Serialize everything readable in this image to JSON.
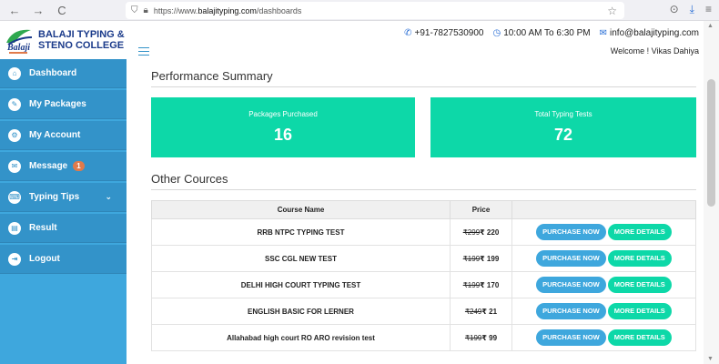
{
  "browser": {
    "back": "←",
    "forward": "→",
    "reload": "C",
    "url_prefix": "https://www.",
    "url_domain": "balajityping.com",
    "url_path": "/dashboards",
    "pocket": "⊙",
    "download": "⤓",
    "menu": "≡"
  },
  "brand": {
    "line1": "BALAJI TYPING &",
    "line2": "STENO COLLEGE",
    "logo_text": "Balaji"
  },
  "sidebar": {
    "items": [
      {
        "label": "Dashboard",
        "icon": "home-icon",
        "glyph": "⌂"
      },
      {
        "label": "My Packages",
        "icon": "edit-icon",
        "glyph": "✎"
      },
      {
        "label": "My Account",
        "icon": "gear-icon",
        "glyph": "⚙"
      },
      {
        "label": "Message",
        "icon": "envelope-icon",
        "glyph": "✉",
        "badge": "1"
      },
      {
        "label": "Typing Tips",
        "icon": "keyboard-icon",
        "glyph": "⌨",
        "chevron": "⌄"
      },
      {
        "label": "Result",
        "icon": "document-icon",
        "glyph": "▤"
      },
      {
        "label": "Logout",
        "icon": "logout-icon",
        "glyph": "⇥"
      }
    ]
  },
  "topbar": {
    "phone": "+91-7827530900",
    "hours": "10:00 AM To 6:30 PM",
    "email": "info@balajityping.com",
    "welcome": "Welcome ! Vikas Dahiya"
  },
  "performance": {
    "title": "Performance Summary",
    "cards": [
      {
        "label": "Packages Purchased",
        "value": "16"
      },
      {
        "label": "Total Typing Tests",
        "value": "72"
      }
    ]
  },
  "courses": {
    "title": "Other Cources",
    "headers": {
      "name": "Course Name",
      "price": "Price"
    },
    "buy_label": "PURCHASE NOW",
    "more_label": "MORE DETAILS",
    "rows": [
      {
        "name": "RRB NTPC TYPING TEST",
        "old_price": "₹299",
        "price": "₹ 220"
      },
      {
        "name": "SSC CGL NEW TEST",
        "old_price": "₹199",
        "price": "₹ 199"
      },
      {
        "name": "DELHI HIGH COURT TYPING TEST",
        "old_price": "₹199",
        "price": "₹ 170"
      },
      {
        "name": "ENGLISH BASIC FOR LERNER",
        "old_price": "₹249",
        "price": "₹ 21"
      },
      {
        "name": "Allahabad high court RO ARO revision test",
        "old_price": "₹199",
        "price": "₹ 99"
      }
    ]
  },
  "colors": {
    "sidebar": "#3ea7dd",
    "menu": "#3393c9",
    "card": "#0dd8a8",
    "badge": "#e07a4b"
  }
}
